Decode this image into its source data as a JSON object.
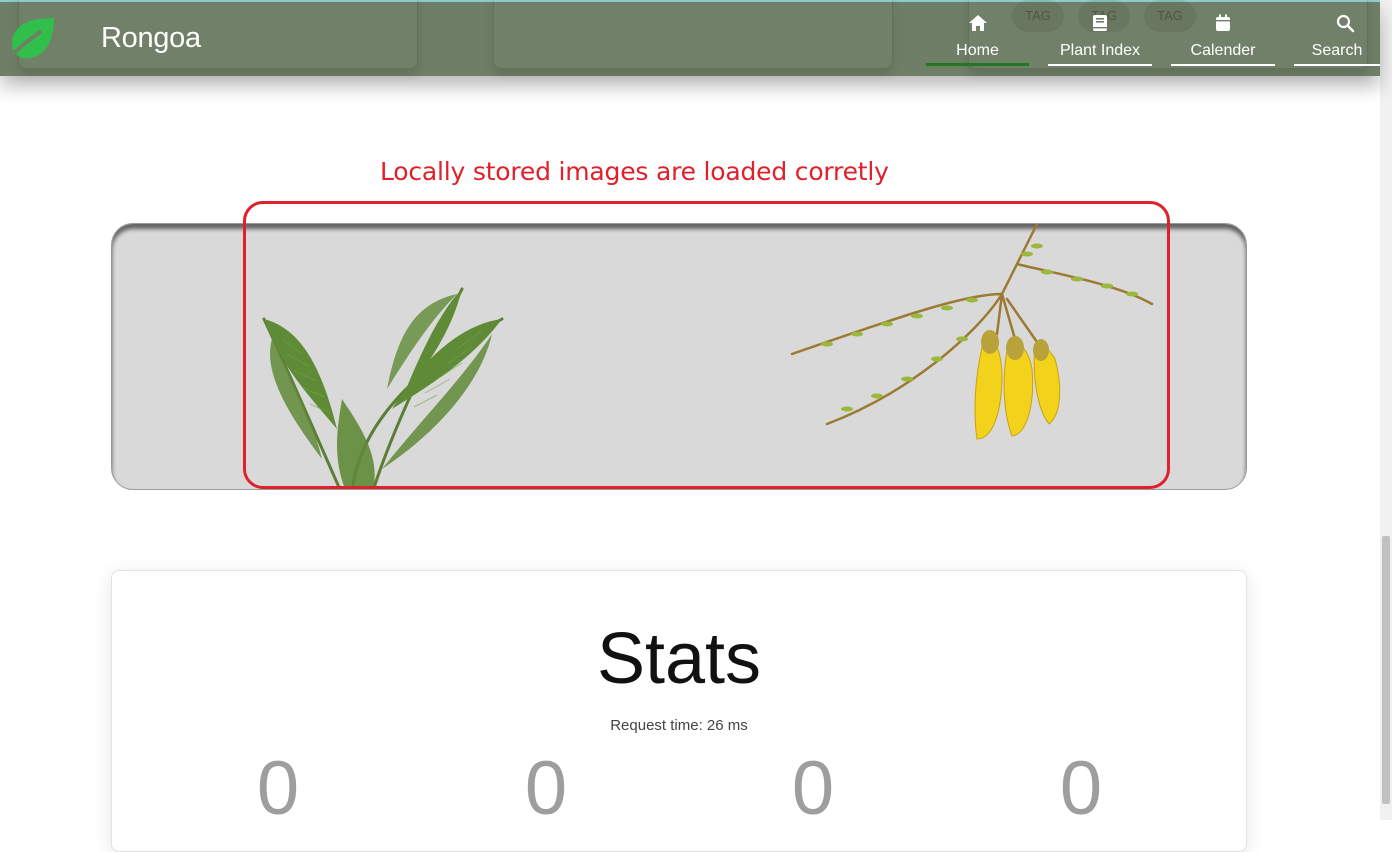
{
  "app": {
    "brand": "Rongoa"
  },
  "navbar": {
    "ghost_tags": [
      "TAG",
      "TAG",
      "TAG"
    ],
    "items": [
      {
        "label": "Home",
        "icon": "home-icon",
        "active": true
      },
      {
        "label": "Plant Index",
        "icon": "book-icon",
        "active": false
      },
      {
        "label": "Calender",
        "icon": "calendar-icon",
        "active": false
      },
      {
        "label": "Search",
        "icon": "search-icon",
        "active": false
      }
    ]
  },
  "annotation": {
    "text": "Locally stored images are loaded corretly",
    "color": "#e0202a"
  },
  "banner": {
    "images": [
      "fern-image",
      "kowhai-flower-image"
    ]
  },
  "stats": {
    "title": "Stats",
    "request_time": "Request time: 26 ms",
    "values": [
      "0",
      "0",
      "0",
      "0"
    ]
  },
  "colors": {
    "navbar": "#6f7f67",
    "logo_green": "#2fbf4a",
    "active_underline": "#1f7a1f",
    "banner_bg": "#d9d9d9"
  }
}
